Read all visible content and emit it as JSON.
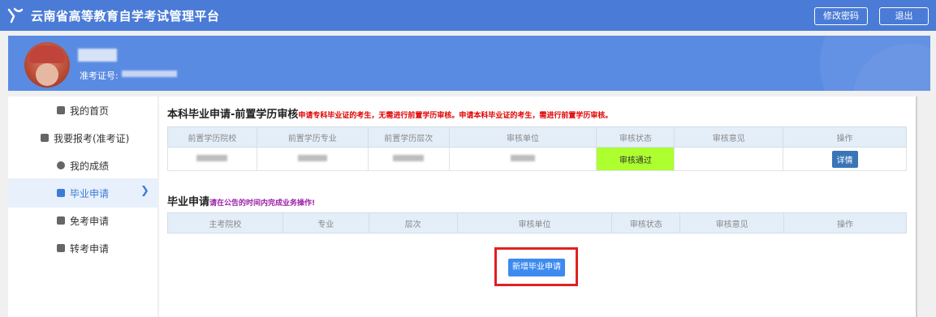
{
  "header": {
    "title": "云南省高等教育自学考试管理平台",
    "change_password": "修改密码",
    "logout": "退出",
    "brand_color": "#4a7bd6"
  },
  "profile": {
    "ticket_label": "准考证号:"
  },
  "sidebar": {
    "items": [
      {
        "label": "我的首页",
        "icon": "home-icon"
      },
      {
        "label": "我要报考(准考证)",
        "icon": "card-icon"
      },
      {
        "label": "我的成绩",
        "icon": "user-icon"
      },
      {
        "label": "毕业申请",
        "icon": "graduation-icon",
        "active": true
      },
      {
        "label": "免考申请",
        "icon": "form-icon"
      },
      {
        "label": "转考申请",
        "icon": "transfer-icon"
      }
    ]
  },
  "section1": {
    "title": "本科毕业申请-前置学历审核",
    "note": "申请专科毕业证的考生，无需进行前置学历审核。申请本科毕业证的考生，需进行前置学历审核。",
    "headers": [
      "前置学历院校",
      "前置学历专业",
      "前置学历层次",
      "审核单位",
      "审核状态",
      "审核意见",
      "操作"
    ],
    "row": {
      "status": "审核通过",
      "opinion": "",
      "action": "详情"
    }
  },
  "section2": {
    "title": "毕业申请",
    "note": "请在公告的时间内完成业务操作!",
    "headers": [
      "主考院校",
      "专业",
      "层次",
      "审核单位",
      "审核状态",
      "审核意见",
      "操作"
    ],
    "add_button": "新增毕业申请"
  }
}
